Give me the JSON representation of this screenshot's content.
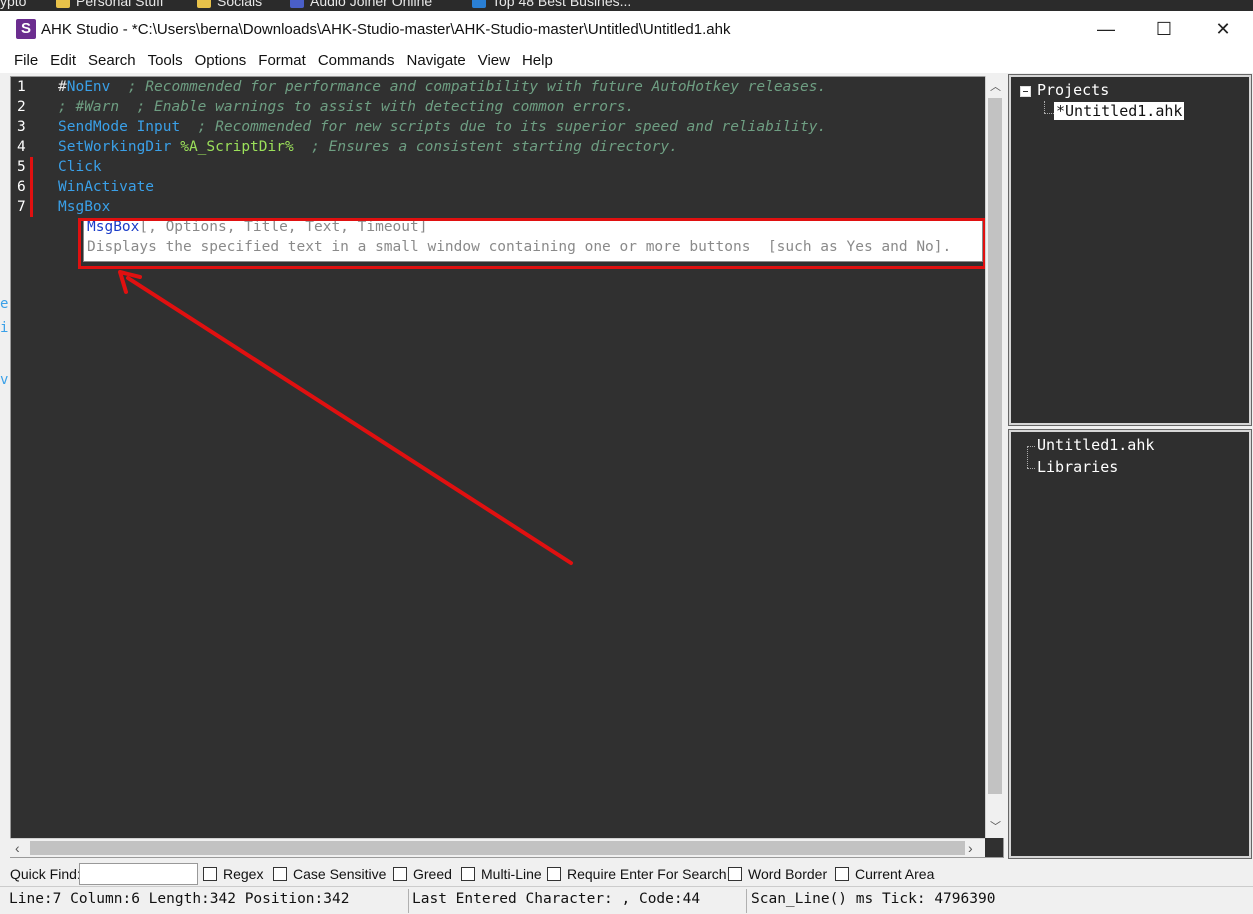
{
  "bookmarks": [
    {
      "label": "ypto",
      "color": ""
    },
    {
      "label": "Personal Stuff",
      "color": "#e8c24a"
    },
    {
      "label": "Socials",
      "color": "#e8c24a"
    },
    {
      "label": "Audio Joiner Online",
      "color": "#4a5fc8"
    },
    {
      "label": "Top 48 Best Busines...",
      "color": "#2a7fd4"
    }
  ],
  "window": {
    "app_icon": "S",
    "title": "AHK Studio - *C:\\Users\\berna\\Downloads\\AHK-Studio-master\\AHK-Studio-master\\Untitled\\Untitled1.ahk",
    "minimize": "—",
    "maximize": "☐",
    "close": "✕"
  },
  "menu": [
    "File",
    "Edit",
    "Search",
    "Tools",
    "Options",
    "Format",
    "Commands",
    "Navigate",
    "View",
    "Help"
  ],
  "editor": {
    "line_numbers": [
      "1",
      "2",
      "3",
      "4",
      "5",
      "6",
      "7"
    ],
    "lines": [
      [
        {
          "t": "#",
          "c": "plain"
        },
        {
          "t": "NoEnv",
          "c": "kw"
        },
        {
          "t": "  ; Recommended for performance and compatibility with future AutoHotkey releases.",
          "c": "cm"
        }
      ],
      [
        {
          "t": "; #Warn  ; Enable warnings to assist with detecting common errors.",
          "c": "cm"
        }
      ],
      [
        {
          "t": "SendMode Input",
          "c": "kw"
        },
        {
          "t": "  ; Recommended for new scripts due to its superior speed and reliability.",
          "c": "cm"
        }
      ],
      [
        {
          "t": "SetWorkingDir ",
          "c": "kw"
        },
        {
          "t": "%A_ScriptDir%",
          "c": "var"
        },
        {
          "t": "  ; Ensures a consistent starting directory.",
          "c": "cm"
        }
      ],
      [
        {
          "t": "Click",
          "c": "kw"
        }
      ],
      [
        {
          "t": "WinActivate",
          "c": "kw"
        }
      ],
      [
        {
          "t": "MsgBox",
          "c": "kw"
        }
      ]
    ],
    "tooltip": {
      "name": "MsgBox",
      "params": "[, Options, Title, Text, Timeout]",
      "description": "Displays the specified text in a small window containing one or more buttons  [such as Yes and No]."
    },
    "left_peek": [
      "e",
      "i",
      "v"
    ]
  },
  "projects": {
    "root": "Projects",
    "file": "*Untitled1.ahk"
  },
  "explorer": {
    "file": "Untitled1.ahk",
    "libraries": "Libraries"
  },
  "quickfind": {
    "label": "Quick Find:",
    "value": "",
    "options": [
      "Regex",
      "Case Sensitive",
      "Greed",
      "Multi-Line",
      "Require Enter For Search",
      "Word Border",
      "Current Area"
    ]
  },
  "status": {
    "position": "Line:7 Column:6 Length:342 Position:342",
    "last_char": "Last Entered Character: , Code:44",
    "scan": "Scan_Line() ms Tick: 4796390"
  },
  "annotation_color": "#e01010"
}
